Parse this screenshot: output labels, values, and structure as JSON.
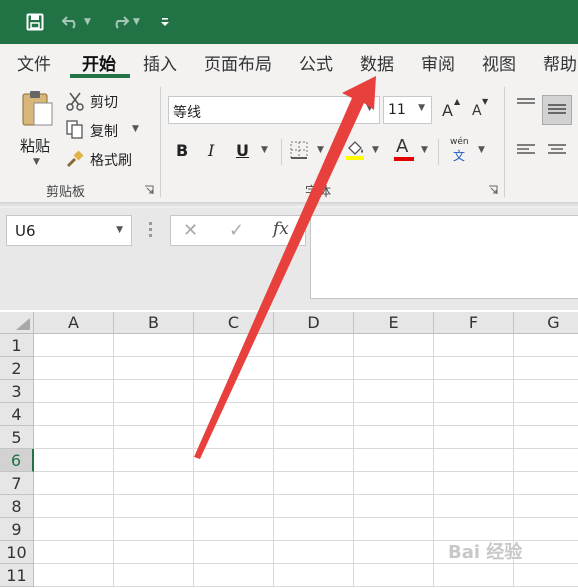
{
  "quick_access": {
    "save_icon": "save-icon",
    "undo_icon": "undo-icon",
    "redo_icon": "redo-icon",
    "customize_icon": "customize-qat-icon"
  },
  "tabs": [
    {
      "label": "文件"
    },
    {
      "label": "开始"
    },
    {
      "label": "插入"
    },
    {
      "label": "页面布局"
    },
    {
      "label": "公式"
    },
    {
      "label": "数据"
    },
    {
      "label": "审阅"
    },
    {
      "label": "视图"
    },
    {
      "label": "帮助"
    }
  ],
  "active_tab": "开始",
  "clipboard": {
    "paste": "粘贴",
    "cut": "剪切",
    "copy": "复制",
    "format_painter": "格式刷",
    "group_label": "剪贴板"
  },
  "font": {
    "name": "等线",
    "size": "11",
    "group_label": "字体",
    "bold": "B",
    "italic": "I",
    "underline": "U",
    "font_color_letter": "A",
    "phonetic_top": "wén",
    "phonetic_bottom": "文",
    "grow": "A",
    "shrink": "A"
  },
  "formula_bar": {
    "name_box": "U6",
    "cancel": "✕",
    "enter": "✓",
    "fx": "fx",
    "content": ""
  },
  "sheet": {
    "columns": [
      "A",
      "B",
      "C",
      "D",
      "E",
      "F",
      "G"
    ],
    "rows": [
      "1",
      "2",
      "3",
      "4",
      "5",
      "6",
      "7",
      "8",
      "9",
      "10",
      "11"
    ],
    "selected_row": "6"
  },
  "colors": {
    "accent": "#217346",
    "arrow": "#e8403c",
    "fill_highlight": "#ffff00",
    "font_color": "#e00000"
  },
  "watermark": "Bai 经验"
}
